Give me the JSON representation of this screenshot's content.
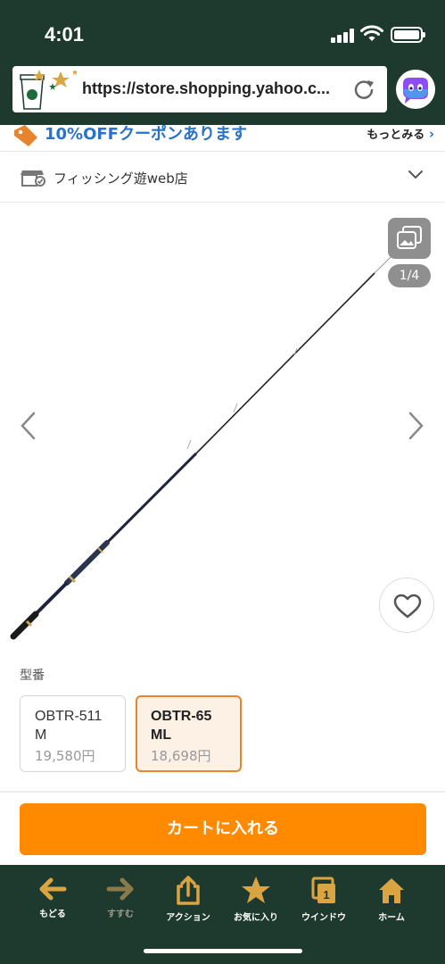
{
  "status_bar": {
    "time": "4:01"
  },
  "browser": {
    "url": "https://store.shopping.yahoo.c...",
    "reload_icon": "reload-icon",
    "extension_icon": "face-bubble-icon"
  },
  "coupon": {
    "text": "10%OFFクーポンあります",
    "more_label": "もっとみる",
    "more_chevron": "›"
  },
  "store": {
    "name": "フィッシング遊web店"
  },
  "gallery": {
    "counter": "1/4"
  },
  "variants": {
    "label": "型番",
    "options": [
      {
        "code_line1": "OBTR-511",
        "code_line2": "M",
        "price": "19,580円",
        "selected": false
      },
      {
        "code_line1": "OBTR-65",
        "code_line2": "ML",
        "price": "18,698円",
        "selected": true
      }
    ]
  },
  "cart": {
    "label": "カートに入れる"
  },
  "toolbar": {
    "items": [
      {
        "label": "もどる",
        "icon": "back-arrow-icon",
        "enabled": true
      },
      {
        "label": "すすむ",
        "icon": "forward-arrow-icon",
        "enabled": false
      },
      {
        "label": "アクション",
        "icon": "share-icon",
        "enabled": true
      },
      {
        "label": "お気に入り",
        "icon": "star-icon",
        "enabled": true
      },
      {
        "label": "ウインドウ",
        "icon": "windows-icon",
        "enabled": true,
        "badge": "1"
      },
      {
        "label": "ホーム",
        "icon": "home-icon",
        "enabled": true
      }
    ]
  },
  "colors": {
    "browser_chrome": "#1e3a2f",
    "accent_gold": "#d9a441",
    "cart_button": "#ff8a00",
    "selected_variant_border": "#e8842e",
    "coupon_text": "#2a72c9"
  }
}
